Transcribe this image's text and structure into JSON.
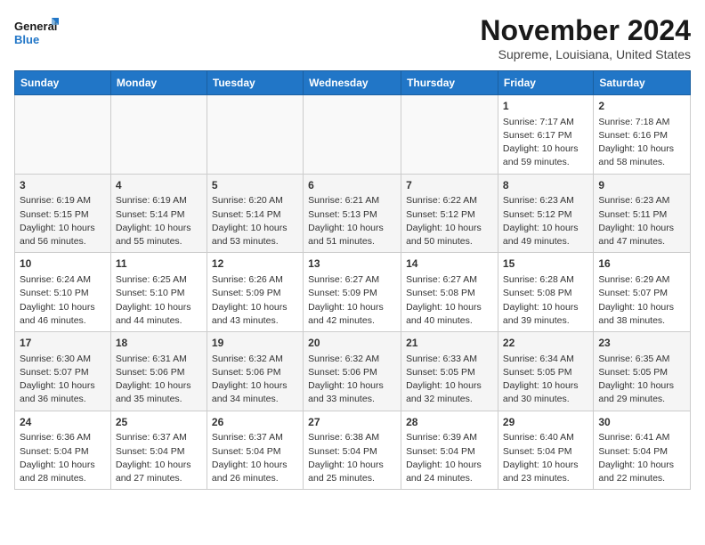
{
  "logo": {
    "line1": "General",
    "line2": "Blue"
  },
  "title": "November 2024",
  "location": "Supreme, Louisiana, United States",
  "days_of_week": [
    "Sunday",
    "Monday",
    "Tuesday",
    "Wednesday",
    "Thursday",
    "Friday",
    "Saturday"
  ],
  "weeks": [
    [
      {
        "day": "",
        "info": ""
      },
      {
        "day": "",
        "info": ""
      },
      {
        "day": "",
        "info": ""
      },
      {
        "day": "",
        "info": ""
      },
      {
        "day": "",
        "info": ""
      },
      {
        "day": "1",
        "info": "Sunrise: 7:17 AM\nSunset: 6:17 PM\nDaylight: 10 hours and 59 minutes."
      },
      {
        "day": "2",
        "info": "Sunrise: 7:18 AM\nSunset: 6:16 PM\nDaylight: 10 hours and 58 minutes."
      }
    ],
    [
      {
        "day": "3",
        "info": "Sunrise: 6:19 AM\nSunset: 5:15 PM\nDaylight: 10 hours and 56 minutes."
      },
      {
        "day": "4",
        "info": "Sunrise: 6:19 AM\nSunset: 5:14 PM\nDaylight: 10 hours and 55 minutes."
      },
      {
        "day": "5",
        "info": "Sunrise: 6:20 AM\nSunset: 5:14 PM\nDaylight: 10 hours and 53 minutes."
      },
      {
        "day": "6",
        "info": "Sunrise: 6:21 AM\nSunset: 5:13 PM\nDaylight: 10 hours and 51 minutes."
      },
      {
        "day": "7",
        "info": "Sunrise: 6:22 AM\nSunset: 5:12 PM\nDaylight: 10 hours and 50 minutes."
      },
      {
        "day": "8",
        "info": "Sunrise: 6:23 AM\nSunset: 5:12 PM\nDaylight: 10 hours and 49 minutes."
      },
      {
        "day": "9",
        "info": "Sunrise: 6:23 AM\nSunset: 5:11 PM\nDaylight: 10 hours and 47 minutes."
      }
    ],
    [
      {
        "day": "10",
        "info": "Sunrise: 6:24 AM\nSunset: 5:10 PM\nDaylight: 10 hours and 46 minutes."
      },
      {
        "day": "11",
        "info": "Sunrise: 6:25 AM\nSunset: 5:10 PM\nDaylight: 10 hours and 44 minutes."
      },
      {
        "day": "12",
        "info": "Sunrise: 6:26 AM\nSunset: 5:09 PM\nDaylight: 10 hours and 43 minutes."
      },
      {
        "day": "13",
        "info": "Sunrise: 6:27 AM\nSunset: 5:09 PM\nDaylight: 10 hours and 42 minutes."
      },
      {
        "day": "14",
        "info": "Sunrise: 6:27 AM\nSunset: 5:08 PM\nDaylight: 10 hours and 40 minutes."
      },
      {
        "day": "15",
        "info": "Sunrise: 6:28 AM\nSunset: 5:08 PM\nDaylight: 10 hours and 39 minutes."
      },
      {
        "day": "16",
        "info": "Sunrise: 6:29 AM\nSunset: 5:07 PM\nDaylight: 10 hours and 38 minutes."
      }
    ],
    [
      {
        "day": "17",
        "info": "Sunrise: 6:30 AM\nSunset: 5:07 PM\nDaylight: 10 hours and 36 minutes."
      },
      {
        "day": "18",
        "info": "Sunrise: 6:31 AM\nSunset: 5:06 PM\nDaylight: 10 hours and 35 minutes."
      },
      {
        "day": "19",
        "info": "Sunrise: 6:32 AM\nSunset: 5:06 PM\nDaylight: 10 hours and 34 minutes."
      },
      {
        "day": "20",
        "info": "Sunrise: 6:32 AM\nSunset: 5:06 PM\nDaylight: 10 hours and 33 minutes."
      },
      {
        "day": "21",
        "info": "Sunrise: 6:33 AM\nSunset: 5:05 PM\nDaylight: 10 hours and 32 minutes."
      },
      {
        "day": "22",
        "info": "Sunrise: 6:34 AM\nSunset: 5:05 PM\nDaylight: 10 hours and 30 minutes."
      },
      {
        "day": "23",
        "info": "Sunrise: 6:35 AM\nSunset: 5:05 PM\nDaylight: 10 hours and 29 minutes."
      }
    ],
    [
      {
        "day": "24",
        "info": "Sunrise: 6:36 AM\nSunset: 5:04 PM\nDaylight: 10 hours and 28 minutes."
      },
      {
        "day": "25",
        "info": "Sunrise: 6:37 AM\nSunset: 5:04 PM\nDaylight: 10 hours and 27 minutes."
      },
      {
        "day": "26",
        "info": "Sunrise: 6:37 AM\nSunset: 5:04 PM\nDaylight: 10 hours and 26 minutes."
      },
      {
        "day": "27",
        "info": "Sunrise: 6:38 AM\nSunset: 5:04 PM\nDaylight: 10 hours and 25 minutes."
      },
      {
        "day": "28",
        "info": "Sunrise: 6:39 AM\nSunset: 5:04 PM\nDaylight: 10 hours and 24 minutes."
      },
      {
        "day": "29",
        "info": "Sunrise: 6:40 AM\nSunset: 5:04 PM\nDaylight: 10 hours and 23 minutes."
      },
      {
        "day": "30",
        "info": "Sunrise: 6:41 AM\nSunset: 5:04 PM\nDaylight: 10 hours and 22 minutes."
      }
    ]
  ]
}
